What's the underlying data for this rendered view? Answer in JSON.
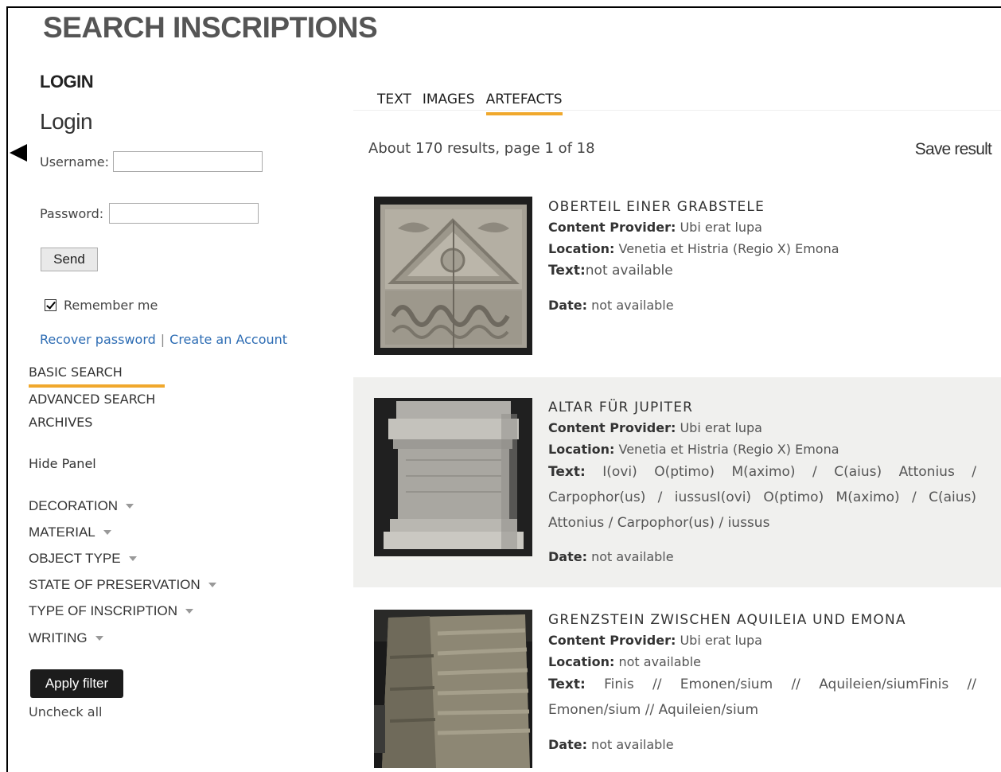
{
  "page": {
    "title": "SEARCH INSCRIPTIONS"
  },
  "login": {
    "heading": "LOGIN",
    "subtitle": "Login",
    "username_label": "Username:",
    "username_value": "",
    "password_label": "Password:",
    "password_value": "",
    "send_label": "Send",
    "remember_label": "Remember me",
    "remember_checked": true,
    "recover_link": "Recover password",
    "separator": "|",
    "create_link": "Create an Account"
  },
  "nav": {
    "basic": "BASIC SEARCH",
    "advanced": "ADVANCED SEARCH",
    "archives": "ARCHIVES",
    "hide_panel": "Hide Panel"
  },
  "facets": [
    {
      "label": "DECORATION"
    },
    {
      "label": "MATERIAL"
    },
    {
      "label": "OBJECT TYPE"
    },
    {
      "label": "STATE OF PRESERVATION"
    },
    {
      "label": "TYPE OF INSCRIPTION"
    },
    {
      "label": "WRITING"
    }
  ],
  "filter": {
    "apply_label": "Apply filter",
    "uncheck_label": "Uncheck all"
  },
  "tabs": [
    {
      "label": "TEXT",
      "active": false
    },
    {
      "label": "IMAGES",
      "active": false
    },
    {
      "label": "ARTEFACTS",
      "active": true
    }
  ],
  "results": {
    "summary": "About 170 results, page 1 of 18",
    "save_label": "Save result",
    "items": [
      {
        "title": "OBERTEIL EINER GRABSTELE",
        "provider_label": "Content Provider:",
        "provider": "Ubi erat lupa",
        "location_label": "Location:",
        "location": "Venetia et Histria (Regio X) Emona",
        "text_label": "Text:",
        "text": "not available",
        "date_label": "Date:",
        "date": "not available"
      },
      {
        "title": "ALTAR FÜR JUPITER",
        "provider_label": "Content Provider:",
        "provider": "Ubi erat lupa",
        "location_label": "Location:",
        "location": "Venetia et Histria (Regio X) Emona",
        "text_label": "Text:",
        "text": "I(ovi) O(ptimo) M(aximo) / C(aius) Attonius / Carpophor(us) / iussusI(ovi) O(ptimo) M(aximo) / C(aius) Attonius / Carpophor(us) / iussus",
        "date_label": "Date:",
        "date": "not available"
      },
      {
        "title": "GRENZSTEIN ZWISCHEN AQUILEIA UND EMONA",
        "provider_label": "Content Provider:",
        "provider": "Ubi erat lupa",
        "location_label": "Location:",
        "location": "not available",
        "text_label": "Text:",
        "text": "Finis // Emonen/sium // Aquileien/siumFinis // Emonen/sium // Aquileien/sium",
        "date_label": "Date:",
        "date": "not available"
      }
    ]
  },
  "colors": {
    "accent": "#f0a82c",
    "link": "#2e6db4",
    "shaded_row": "#f0f0ee"
  },
  "icons": {
    "collapse": "triangle-left-icon",
    "facet_toggle": "caret-down-icon",
    "checkbox": "checkbox-checked-icon"
  }
}
